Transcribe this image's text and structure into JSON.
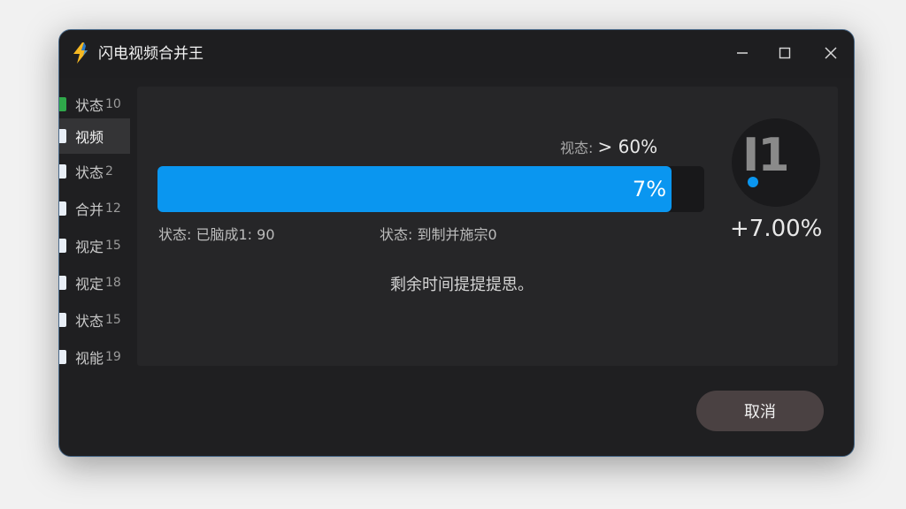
{
  "window": {
    "title": "闪电视频合并王",
    "app_icon": "lightning-icon",
    "controls": [
      "minimize-icon",
      "maximize-icon",
      "close-icon"
    ]
  },
  "sidebar": {
    "items": [
      {
        "label": "状态",
        "num": "10",
        "icon": "file-icon",
        "active": false
      },
      {
        "label": "视频",
        "num": "",
        "icon": "file-icon",
        "active": true
      },
      {
        "label": "状态",
        "num": "2",
        "icon": "file-icon",
        "active": false
      },
      {
        "label": "合并",
        "num": "12",
        "icon": "file-icon",
        "active": false
      },
      {
        "label": "视定",
        "num": "15",
        "icon": "file-icon",
        "active": false
      },
      {
        "label": "视定",
        "num": "18",
        "icon": "file-icon",
        "active": false
      },
      {
        "label": "状态",
        "num": "15",
        "icon": "file-icon",
        "active": false
      },
      {
        "label": "视能",
        "num": "19",
        "icon": "file-icon",
        "active": false
      }
    ]
  },
  "progress": {
    "top_label": "视态:",
    "top_value": "> 60%",
    "percent": 0.94,
    "bar_label": "7%",
    "status_left": "状态: 已脑成1: 90",
    "status_mid": "状态: 到制并施宗0",
    "remaining": "剩余时间提提提思。",
    "circle_text": "I1",
    "delta": "+7.00%"
  },
  "footer": {
    "cancel_label": "取消"
  },
  "colors": {
    "accent": "#0a96f0",
    "window_bg": "#1f1f21",
    "panel_bg": "#262628",
    "cancel_bg": "#4a4142"
  }
}
